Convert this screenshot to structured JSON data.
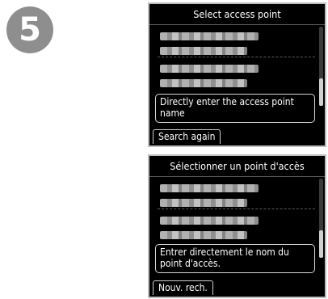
{
  "step": {
    "number": "5"
  },
  "screens": [
    {
      "title": "Select access point",
      "direct_entry_label": "Directly enter the access point name",
      "bottom_button_label": "Search again"
    },
    {
      "title": "Sélectionner un point d'accès",
      "direct_entry_label": "Entrer directement le nom du point d'accès.",
      "bottom_button_label": "Nouv. rech."
    }
  ],
  "colors": {
    "screen_bg": "#000000",
    "badge": "#8e8e8e",
    "text": "#ffffff"
  }
}
